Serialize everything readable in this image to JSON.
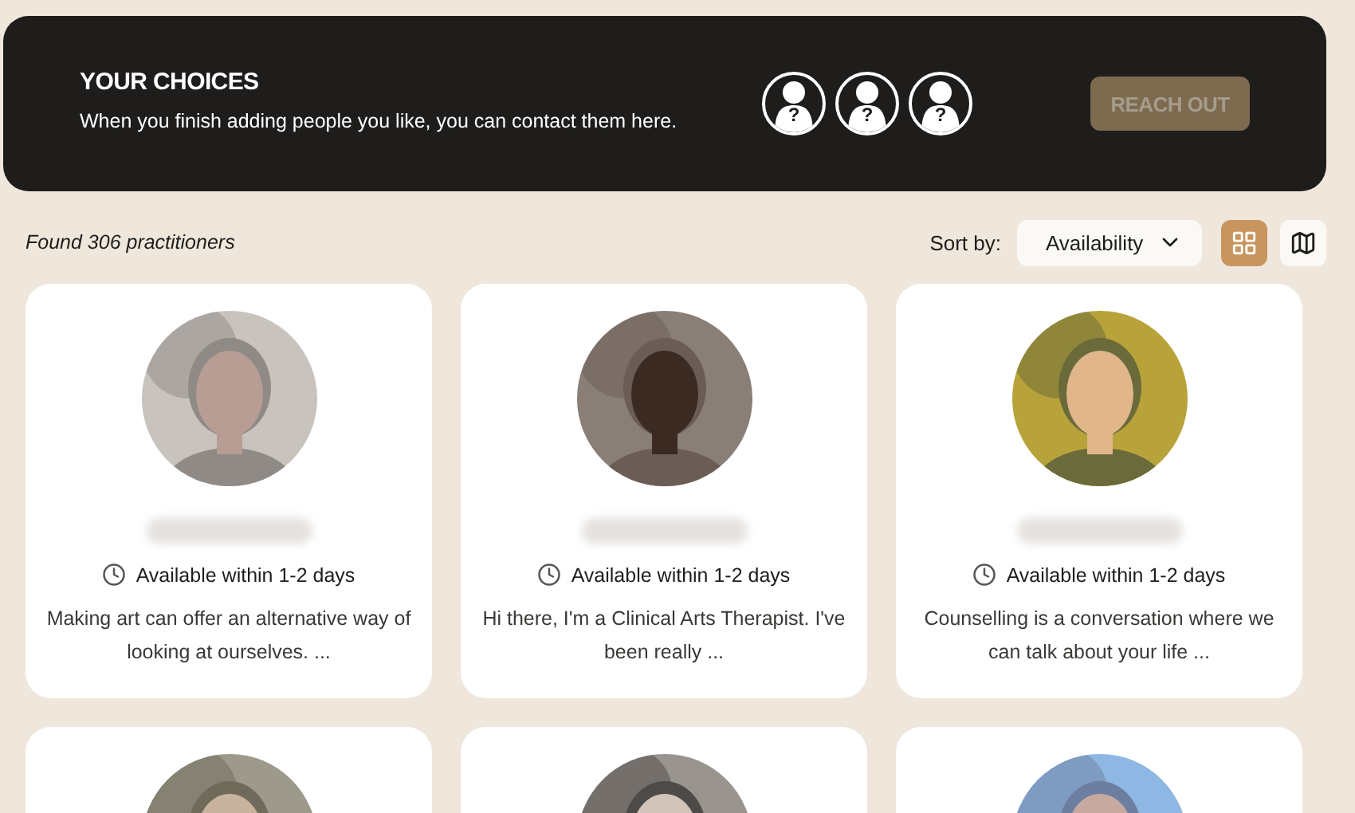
{
  "choices": {
    "title": "YOUR CHOICES",
    "message": "When you finish adding people you like, you can contact them here.",
    "slots": [
      {
        "mark": "?"
      },
      {
        "mark": "?"
      },
      {
        "mark": "?"
      }
    ],
    "button": {
      "label": "REACH OUT",
      "disabled": true
    }
  },
  "toolbar": {
    "result_count": "Found 306 practitioners",
    "sort_label": "Sort by:",
    "sort_value": "Availability",
    "views": [
      {
        "kind": "grid",
        "selected": true
      },
      {
        "kind": "map",
        "selected": false
      }
    ]
  },
  "cards": [
    {
      "kind": "full",
      "availability": "Available within 1-2 days",
      "summary": "Making art can offer an alternative way of looking at ourselves. ..."
    },
    {
      "kind": "full",
      "availability": "Available within 1-2 days",
      "summary": "Hi there, I'm a Clinical Arts Therapist. I've been really ..."
    },
    {
      "kind": "full",
      "availability": "Available within 1-2 days",
      "summary": "Counselling is a conversation where we can talk about your life ..."
    },
    {
      "kind": "picture"
    },
    {
      "kind": "picture"
    },
    {
      "kind": "picture"
    }
  ]
}
